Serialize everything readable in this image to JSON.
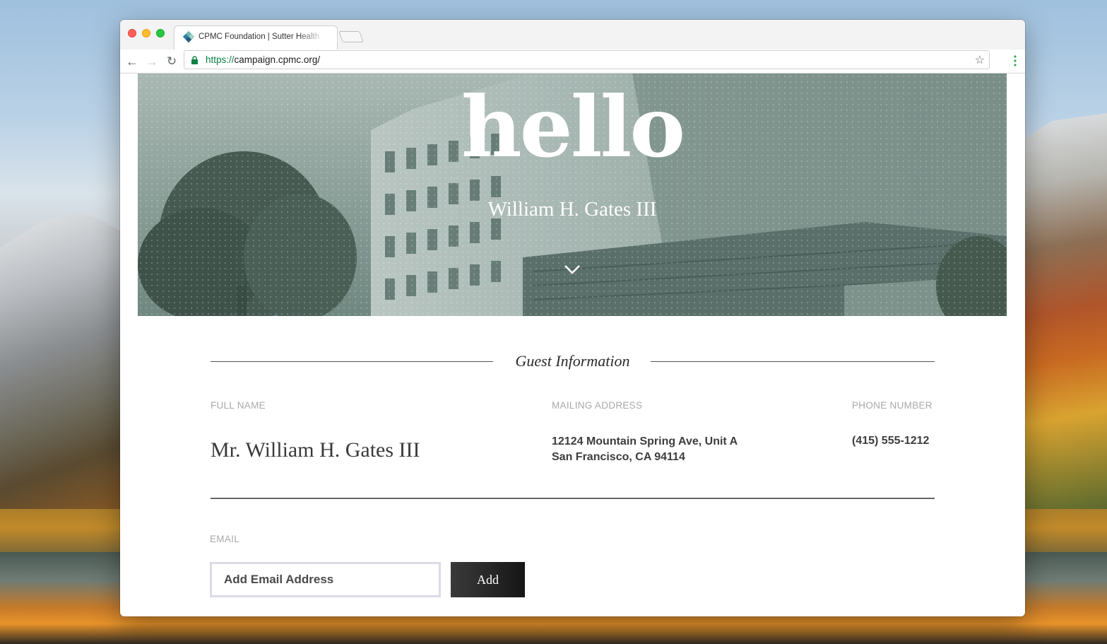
{
  "browser": {
    "tab_title": "CPMC Foundation | Sutter Health",
    "url_protocol": "https://",
    "url_rest": "campaign.cpmc.org/"
  },
  "hero": {
    "greeting": "hello",
    "name": "William H. Gates III"
  },
  "guest_info": {
    "title": "Guest Information",
    "columns": {
      "full_name_label": "FULL NAME",
      "mailing_address_label": "MAILING ADDRESS",
      "phone_label": "PHONE NUMBER"
    },
    "full_name": "Mr. William H. Gates III",
    "address_line1": "12124 Mountain Spring Ave, Unit A",
    "address_line2": "San Francisco, CA 94114",
    "phone": "(415) 555-1212"
  },
  "email_section": {
    "label": "EMAIL",
    "placeholder": "Add Email Address",
    "add_button": "Add"
  },
  "colors": {
    "hero_tint": "#5c746c",
    "accent_button": "#161616",
    "secure_green": "#0b8043"
  },
  "icons": [
    "back-arrow-icon",
    "forward-arrow-icon",
    "reload-icon",
    "lock-icon",
    "star-icon",
    "menu-dots-icon",
    "chevron-down-icon",
    "favicon-icon"
  ]
}
